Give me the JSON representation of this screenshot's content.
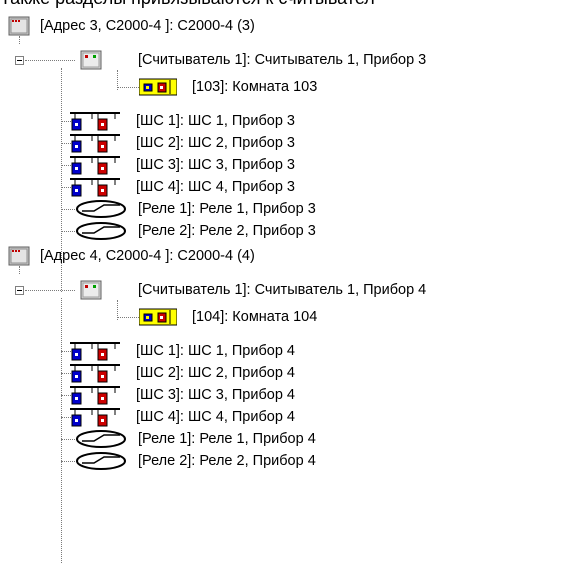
{
  "header": {
    "cutoff_text": "Также разделы привязываются к считывател"
  },
  "tree": {
    "devices": [
      {
        "label": "[Адрес 3, С2000-4 ]: С2000-4 (3)",
        "reader": {
          "label": "[Считыватель 1]: Считыватель 1, Прибор 3",
          "room": "[103]: Комната 103"
        },
        "zones": [
          "[ШС 1]: ШС 1, Прибор 3",
          "[ШС 2]: ШС 2, Прибор 3",
          "[ШС 3]: ШС 3, Прибор 3",
          "[ШС 4]: ШС 4, Прибор 3"
        ],
        "relays": [
          "[Реле 1]: Реле 1, Прибор 3",
          "[Реле 2]: Реле 2, Прибор 3"
        ]
      },
      {
        "label": "[Адрес 4, С2000-4 ]: С2000-4 (4)",
        "reader": {
          "label": "[Считыватель 1]: Считыватель 1, Прибор 4",
          "room": "[104]: Комната 104"
        },
        "zones": [
          "[ШС 1]: ШС 1, Прибор 4",
          "[ШС 2]: ШС 2, Прибор 4",
          "[ШС 3]: ШС 3, Прибор 4",
          "[ШС 4]: ШС 4, Прибор 4"
        ],
        "relays": [
          "[Реле 1]: Реле 1, Прибор 4",
          "[Реле 2]: Реле 2, Прибор 4"
        ]
      }
    ]
  },
  "icons": {
    "device": "device-icon",
    "reader": "reader-icon",
    "room": "room-icon",
    "zone": "zone-loop-icon",
    "relay": "relay-icon"
  },
  "colors": {
    "room_bg": "#ffff00",
    "zone_blue": "#0000cc",
    "zone_red": "#cc0000",
    "device_red": "#c00000"
  }
}
